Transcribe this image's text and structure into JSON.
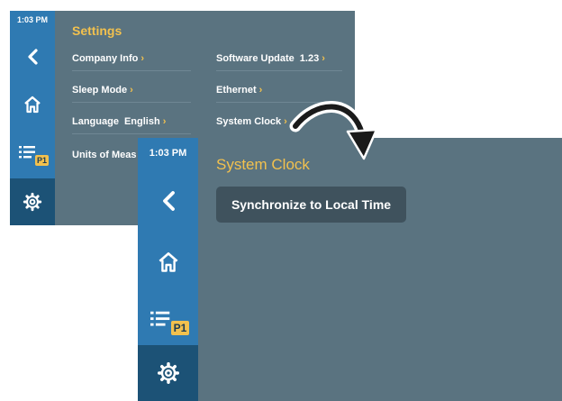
{
  "back_screen": {
    "time": "1:03 PM",
    "title": "Settings",
    "nav": [
      "back-icon",
      "home-icon",
      "list-icon",
      "gear-icon"
    ],
    "p1_badge": "P1",
    "menu_left": [
      {
        "label": "Company Info",
        "value": ""
      },
      {
        "label": "Sleep Mode",
        "value": ""
      },
      {
        "label": "Language",
        "value": "English"
      },
      {
        "label": "Units of Meas",
        "value": ""
      }
    ],
    "menu_right": [
      {
        "label": "Software Update",
        "value": "1.23"
      },
      {
        "label": "Ethernet",
        "value": ""
      },
      {
        "label": "System Clock",
        "value": ""
      }
    ],
    "chevron": "›"
  },
  "front_screen": {
    "time": "1:03 PM",
    "title": "System Clock",
    "nav": [
      "back-icon",
      "home-icon",
      "list-icon",
      "gear-icon"
    ],
    "p1_badge": "P1",
    "sync_button_label": "Synchronize to Local Time"
  },
  "colors": {
    "panel_bg": "#5a7380",
    "sidebar": "#2f7ab2",
    "sidebar_active": "#1c5276",
    "title": "#f2c14e",
    "button_bg": "#3f525d"
  },
  "arrow_icon": "curved-arrow-icon"
}
